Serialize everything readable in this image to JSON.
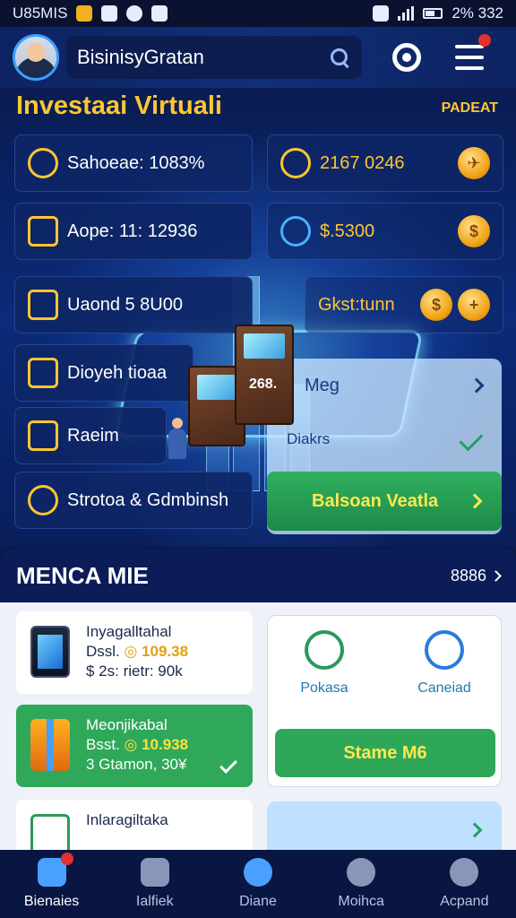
{
  "status_bar": {
    "left_text": "U85MIS",
    "right_text": "2% 332"
  },
  "header": {
    "search_text": "BisinisyGratan"
  },
  "hero": {
    "title": "Investaai Virtuali",
    "tag": "PADEAT",
    "stats_left": [
      {
        "label": "Sahoeae: 1083%"
      },
      {
        "label": "Aope: 11: 12936"
      },
      {
        "label": "Uaond 5 8U00"
      },
      {
        "label": "Dioyeh tioaa"
      },
      {
        "label": "Raeim"
      },
      {
        "label": "Strotoa & Gdmbinsh"
      }
    ],
    "stats_right": [
      {
        "label": "2167 0246"
      },
      {
        "label": "$.5300"
      },
      {
        "label": "Gkst:tunn"
      }
    ],
    "box_label": "268.",
    "panel_rows": [
      "Meg",
      "Diakrs"
    ],
    "cta_label": "Balsoan Veatla"
  },
  "section": {
    "title": "MENCA MIE",
    "link": "8886"
  },
  "list": [
    {
      "title": "Inyagalltahal",
      "line2_prefix": "Dssl.",
      "amount": "109.38",
      "line3": "$ 2s: rietr: 90k"
    },
    {
      "title": "Meonjikabal",
      "line2_prefix": "Bsst.",
      "amount": "10.938",
      "line3": "3 Gtamon, 30¥"
    },
    {
      "title": "Inlaragiltaka",
      "line2_prefix": "",
      "amount": "",
      "line3": ""
    }
  ],
  "actions": {
    "left": "Pokasa",
    "right": "Caneiad",
    "start_label": "Stame M6"
  },
  "nav": [
    {
      "label": "Bienaies"
    },
    {
      "label": "Ialfiek"
    },
    {
      "label": "Diane"
    },
    {
      "label": "Moihca"
    },
    {
      "label": "Acpand"
    }
  ]
}
